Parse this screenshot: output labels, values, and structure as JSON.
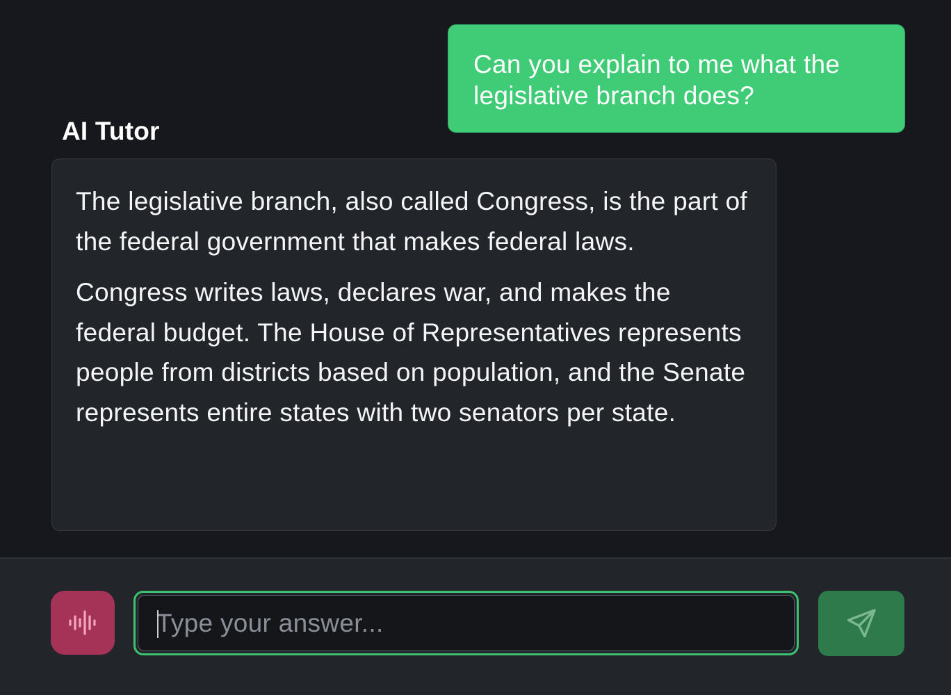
{
  "conversation": {
    "user_message": "Can you explain to me what the legislative branch does?",
    "tutor_name": "AI Tutor",
    "tutor_paragraphs": [
      "The legislative branch, also called Congress, is the part of the federal government that makes federal laws.",
      "Congress writes laws, declares war, and makes the federal budget. The House of Representatives represents people from districts based on population, and the Senate represents entire states with two senators per state."
    ]
  },
  "composer": {
    "input_placeholder": "Type your answer...",
    "input_value": "",
    "voice_icon": "audio-waveform-icon",
    "send_icon": "send-paper-plane-icon"
  },
  "colors": {
    "user_bubble": "#40cc76",
    "tutor_bubble": "#22252a",
    "background": "#16181d",
    "voice_button": "#a53257",
    "send_button": "#2f7a4a",
    "input_focus_ring": "#3ec271"
  }
}
